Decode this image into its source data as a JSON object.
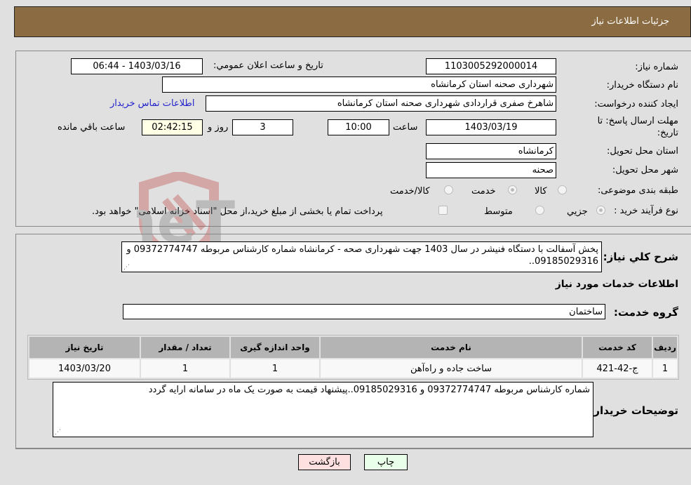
{
  "header": {
    "title": "جزئیات اطلاعات نیاز"
  },
  "form": {
    "need_number_label": "شماره نیاز:",
    "need_number": "1103005292000014",
    "announce_label": "تاریخ و ساعت اعلان عمومي:",
    "announce_value": "1403/03/16 - 06:44",
    "buyer_org_label": "نام دستگاه خریدار:",
    "buyer_org": "شهرداری صحنه استان کرمانشاه",
    "creator_label": "ایجاد کننده درخواست:",
    "creator": "شاهرخ صفری قراردادی شهرداری صحنه استان کرمانشاه",
    "contact_link": "اطلاعات تماس خریدار",
    "deadline_label_1": "مهلت ارسال پاسخ: تا",
    "deadline_label_2": "تاریخ:",
    "deadline_date": "1403/03/19",
    "time_label": "ساعت",
    "deadline_time": "10:00",
    "days_value": "3",
    "days_label": "روز و",
    "remaining_time": "02:42:15",
    "remaining_label": "ساعت باقي مانده",
    "province_label": "استان محل تحویل:",
    "province": "کرمانشاه",
    "city_label": "شهر محل تحویل:",
    "city": "صحنه",
    "category_label": "طبقه بندی موضوعی:",
    "category_options": [
      "کالا",
      "خدمت",
      "کالا/خدمت"
    ],
    "category_selected": "خدمت",
    "process_label": "نوع فرآیند خرید :",
    "process_options": [
      "جزيي",
      "متوسط"
    ],
    "process_selected": "جزيي",
    "treasury_note": "پرداخت تمام یا بخشی از مبلغ خرید،از محل \"اسناد خزانه اسلامی\" خواهد بود."
  },
  "details": {
    "summary_label": "شرح کلي نياز:",
    "summary": "پخش آسفالت با دستگاه فنیشر در سال 1403 جهت شهرداری صحه - کرمانشاه  شماره کارشناس مربوطه 09372774747 و 09185029316..",
    "services_heading": "اطلاعات خدمات مورد نیاز",
    "service_group_label": "گروه خدمت:",
    "service_group": "ساختمان",
    "table": {
      "headers": [
        "ردیف",
        "کد خدمت",
        "نام خدمت",
        "واحد اندازه گیری",
        "تعداد / مقدار",
        "تاریخ نیاز"
      ],
      "rows": [
        [
          "1",
          "ج-42-421",
          "ساخت جاده و راه‌آهن",
          "1",
          "1",
          "1403/03/20"
        ]
      ]
    },
    "buyer_notes_label": "توضیحات خریدار:",
    "buyer_notes": "شماره کارشناس مربوطه 09372774747 و 09185029316..پیشنهاد قیمت به صورت یک ماه در سامانه ارایه گردد"
  },
  "buttons": {
    "print": "چاپ",
    "back": "بازگشت"
  },
  "watermark": "AriaTender.neT",
  "colors": {
    "header_bg": "#8b6c42",
    "print_bg": "#eaffea",
    "back_bg": "#ffe0e0",
    "link": "#2222cc"
  }
}
